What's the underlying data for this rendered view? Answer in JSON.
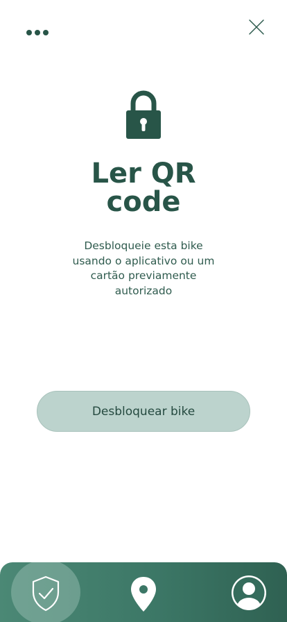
{
  "header": {
    "menu_icon": "more-horizontal-icon",
    "close_icon": "close-icon"
  },
  "main": {
    "lock_icon": "lock-icon",
    "title": "Ler QR\ncode",
    "description": "Desbloqueie esta bike usando o aplicativo ou um cartão previamente autorizado",
    "unlock_button_label": "Desbloquear bike"
  },
  "tab_bar": {
    "active_tab": "shield",
    "tabs": [
      {
        "icon": "shield-check-icon",
        "active": true
      },
      {
        "icon": "location-pin-icon",
        "active": false
      },
      {
        "icon": "user-profile-icon",
        "active": false
      }
    ]
  },
  "colors": {
    "primary": "#285548",
    "button_bg": "#bcd3cd",
    "tab_bar_start": "#4b8875",
    "tab_bar_end": "#2f6152"
  }
}
